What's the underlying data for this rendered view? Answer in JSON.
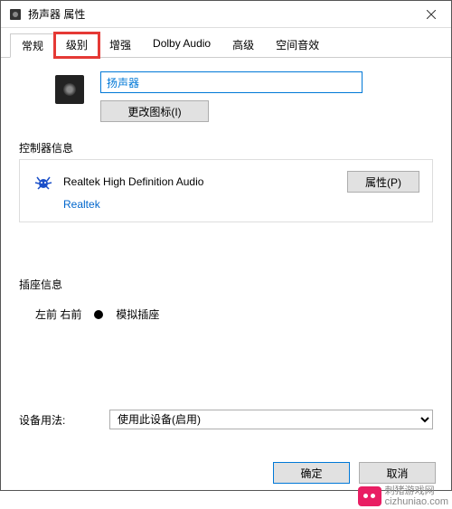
{
  "window": {
    "title": "扬声器 属性"
  },
  "tabs": [
    {
      "label": "常规",
      "active": true
    },
    {
      "label": "级别",
      "active": false,
      "highlighted": true
    },
    {
      "label": "增强",
      "active": false
    },
    {
      "label": "Dolby Audio",
      "active": false
    },
    {
      "label": "高级",
      "active": false
    },
    {
      "label": "空间音效",
      "active": false
    }
  ],
  "device": {
    "name_value": "扬声器",
    "change_icon_btn": "更改图标(I)"
  },
  "controller": {
    "group_label": "控制器信息",
    "name": "Realtek High Definition Audio",
    "vendor": "Realtek",
    "properties_btn": "属性(P)"
  },
  "jack": {
    "group_label": "插座信息",
    "position": "左前 右前",
    "type": "模拟插座"
  },
  "usage": {
    "label": "设备用法:",
    "selected": "使用此设备(启用)"
  },
  "buttons": {
    "ok": "确定",
    "cancel": "取消"
  },
  "watermark": {
    "line1": "刺猪游戏网",
    "line2": "cizhuniao.com"
  }
}
